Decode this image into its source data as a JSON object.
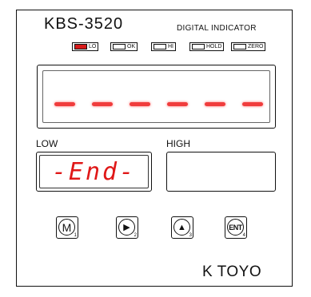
{
  "header": {
    "model": "KBS-3520",
    "subtitle": "DIGITAL INDICATOR"
  },
  "indicators": [
    {
      "label": "LO",
      "lit": true
    },
    {
      "label": "OK",
      "lit": false
    },
    {
      "label": "HI",
      "lit": false
    },
    {
      "label": "HOLD",
      "lit": false
    },
    {
      "label": "ZERO",
      "lit": false
    }
  ],
  "main_display": {
    "segments": [
      "-",
      "-",
      "-",
      "-",
      "-",
      "-"
    ],
    "color": "#f03c3c"
  },
  "low": {
    "label": "LOW",
    "value": "-End-",
    "color": "#e01818"
  },
  "high": {
    "label": "HIGH",
    "value": ""
  },
  "buttons": [
    {
      "name": "mode",
      "glyph": "M",
      "number": "1"
    },
    {
      "name": "shift",
      "glyph": "▶",
      "number": "2"
    },
    {
      "name": "up",
      "glyph": "▲",
      "number": "3"
    },
    {
      "name": "enter",
      "glyph": "ENT",
      "number": "4"
    }
  ],
  "brand": "K TOYO"
}
